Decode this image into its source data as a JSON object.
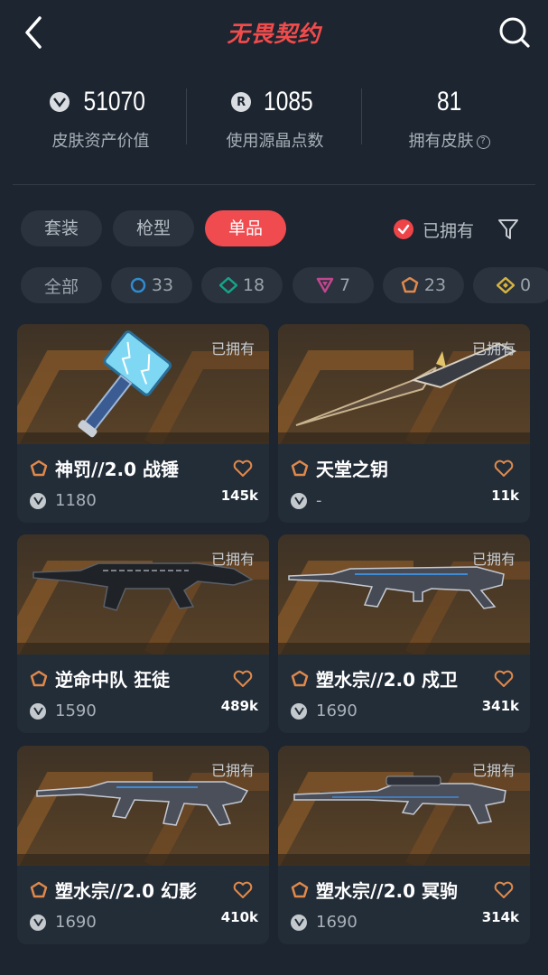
{
  "header": {
    "title": "无畏契约"
  },
  "stats": [
    {
      "value": "51070",
      "label": "皮肤资产价值",
      "icon": "vp-coin-icon"
    },
    {
      "value": "1085",
      "label": "使用源晶点数",
      "icon": "radianite-icon"
    },
    {
      "value": "81",
      "label": "拥有皮肤",
      "icon": ""
    }
  ],
  "tabs": [
    {
      "label": "套装",
      "active": false
    },
    {
      "label": "枪型",
      "active": false
    },
    {
      "label": "单品",
      "active": true
    }
  ],
  "owned_filter": {
    "label": "已拥有",
    "checked": true
  },
  "chips": [
    {
      "label": "全部",
      "icon": ""
    },
    {
      "label": "33",
      "icon": "select-tier-icon",
      "color": "#2f8bd0"
    },
    {
      "label": "18",
      "icon": "deluxe-tier-icon",
      "color": "#17a288"
    },
    {
      "label": "7",
      "icon": "premium-tier-icon",
      "color": "#c2468e"
    },
    {
      "label": "23",
      "icon": "exclusive-tier-icon",
      "color": "#e0894b"
    },
    {
      "label": "0",
      "icon": "ultra-tier-icon",
      "color": "#d6b23f"
    }
  ],
  "cards": [
    {
      "name": "神罚//2.0 战锤",
      "price": "1180",
      "likes": "145k",
      "owned": "已拥有",
      "weapon": "hammer"
    },
    {
      "name": "天堂之钥",
      "price": "-",
      "likes": "11k",
      "owned": "已拥有",
      "weapon": "dagger"
    },
    {
      "name": "逆命中队 狂徒",
      "price": "1590",
      "likes": "489k",
      "owned": "已拥有",
      "weapon": "vandal"
    },
    {
      "name": "塑水宗//2.0 戍卫",
      "price": "1690",
      "likes": "341k",
      "owned": "已拥有",
      "weapon": "guardian"
    },
    {
      "name": "塑水宗//2.0 幻影",
      "price": "1690",
      "likes": "410k",
      "owned": "已拥有",
      "weapon": "phantom"
    },
    {
      "name": "塑水宗//2.0 冥驹",
      "price": "1690",
      "likes": "314k",
      "owned": "已拥有",
      "weapon": "operator"
    }
  ],
  "colors": {
    "accent": "#f04b4f",
    "background": "#1c2530",
    "card": "#232d38",
    "exclusive": "#e0894b"
  }
}
